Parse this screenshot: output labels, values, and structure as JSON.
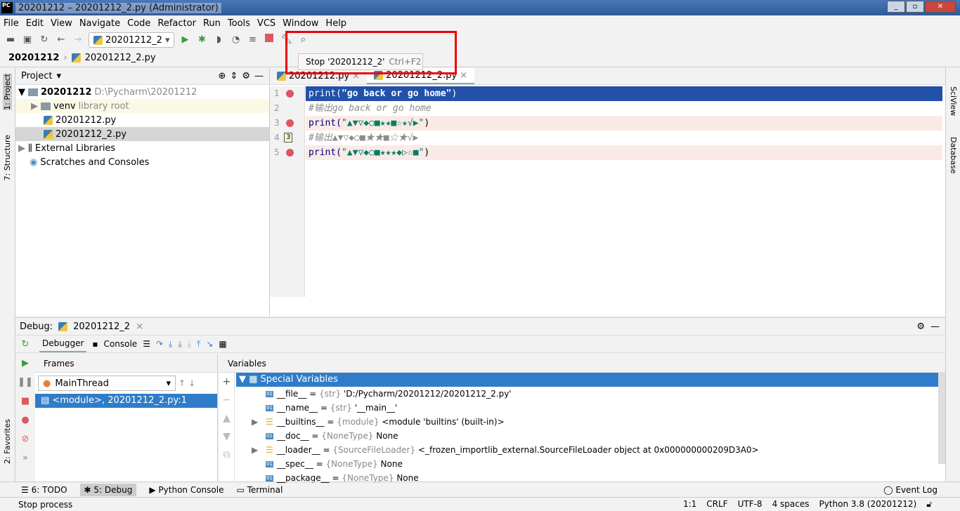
{
  "window": {
    "title": "20201212 – 20201212_2.py (Administrator)",
    "logo": "PC"
  },
  "menu": [
    "File",
    "Edit",
    "View",
    "Navigate",
    "Code",
    "Refactor",
    "Run",
    "Tools",
    "VCS",
    "Window",
    "Help"
  ],
  "toolbar": {
    "run_config": "20201212_2",
    "tooltip": {
      "text": "Stop '20201212_2'",
      "shortcut": "Ctrl+F2"
    }
  },
  "breadcrumb": {
    "project": "20201212",
    "file": "20201212_2.py"
  },
  "left_strip": {
    "project": "1: Project",
    "structure": "7: Structure",
    "favorites": "2: Favorites"
  },
  "right_strip": {
    "sciview": "SciView",
    "database": "Database"
  },
  "project": {
    "header": "Project",
    "root": "20201212",
    "root_path": "D:\\Pycharm\\20201212",
    "venv": "venv",
    "venv_note": "library root",
    "files": [
      "20201212.py",
      "20201212_2.py"
    ],
    "external": "External Libraries",
    "scratches": "Scratches and Consoles"
  },
  "editor": {
    "tabs": [
      "20201212.py",
      "20201212_2.py"
    ],
    "lines": [
      {
        "n": "1",
        "fn": "print(",
        "str": "\"go back or go home\"",
        "end": ")"
      },
      {
        "n": "2",
        "comment": "#输出go back or go home"
      },
      {
        "n": "3",
        "fn": "print(",
        "str": "\"▲▼▽◆○■★★■☆★√▶\"",
        "end": ")"
      },
      {
        "n": "4",
        "comment": "#输出▲▼▽◆○■★★■☆★√▶",
        "badge": "3"
      },
      {
        "n": "5",
        "fn": "print(",
        "str": "\"▲▼▽◆○■★★★◆▷☆■\"",
        "end": ")"
      }
    ]
  },
  "debug": {
    "label": "Debug:",
    "session": "20201212_2",
    "tabs": [
      "Debugger",
      "Console"
    ],
    "frames_header": "Frames",
    "thread": "MainThread",
    "frame": "<module>, 20201212_2.py:1",
    "variables_header": "Variables",
    "special": "Special Variables",
    "vars": [
      {
        "name": "__file__",
        "type": "{str}",
        "value": "'D:/Pycharm/20201212/20201212_2.py'"
      },
      {
        "name": "__name__",
        "type": "{str}",
        "value": "'__main__'"
      },
      {
        "name": "__builtins__",
        "type": "{module}",
        "value": "<module 'builtins' (built-in)>"
      },
      {
        "name": "__doc__",
        "type": "{NoneType}",
        "value": "None"
      },
      {
        "name": "__loader__",
        "type": "{SourceFileLoader}",
        "value": "<_frozen_importlib_external.SourceFileLoader object at 0x000000000209D3A0>"
      },
      {
        "name": "__spec__",
        "type": "{NoneType}",
        "value": "None"
      },
      {
        "name": "__package__",
        "type": "{NoneType}",
        "value": "None"
      }
    ]
  },
  "bottom_tabs": [
    "6: TODO",
    "5: Debug",
    "Python Console",
    "Terminal"
  ],
  "event_log": "Event Log",
  "status": {
    "message": "Stop process",
    "position": "1:1",
    "line_sep": "CRLF",
    "encoding": "UTF-8",
    "indent": "4 spaces",
    "interpreter": "Python 3.8 (20201212)"
  }
}
